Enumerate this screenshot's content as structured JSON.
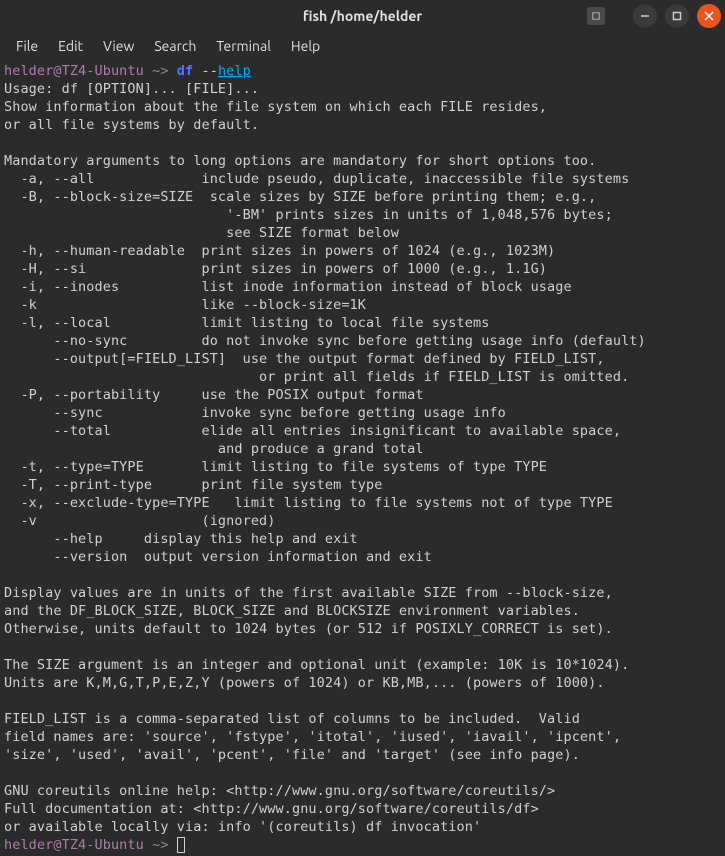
{
  "window": {
    "title": "fish  /home/helder"
  },
  "menu": {
    "file": "File",
    "edit": "Edit",
    "view": "View",
    "search": "Search",
    "terminal": "Terminal",
    "help": "Help"
  },
  "prompt": {
    "user_host": "helder@TZ4-Ubuntu",
    "path_sep": " ~> ",
    "cmd": "df",
    "flag_prefix": " --",
    "flag_name": "help"
  },
  "output": {
    "l01": "Usage: df [OPTION]... [FILE]...",
    "l02": "Show information about the file system on which each FILE resides,",
    "l03": "or all file systems by default.",
    "l04": "",
    "l05": "Mandatory arguments to long options are mandatory for short options too.",
    "l06": "  -a, --all             include pseudo, duplicate, inaccessible file systems",
    "l07": "  -B, --block-size=SIZE  scale sizes by SIZE before printing them; e.g.,",
    "l08": "                           '-BM' prints sizes in units of 1,048,576 bytes;",
    "l09": "                           see SIZE format below",
    "l10": "  -h, --human-readable  print sizes in powers of 1024 (e.g., 1023M)",
    "l11": "  -H, --si              print sizes in powers of 1000 (e.g., 1.1G)",
    "l12": "  -i, --inodes          list inode information instead of block usage",
    "l13": "  -k                    like --block-size=1K",
    "l14": "  -l, --local           limit listing to local file systems",
    "l15": "      --no-sync         do not invoke sync before getting usage info (default)",
    "l16": "      --output[=FIELD_LIST]  use the output format defined by FIELD_LIST,",
    "l17": "                               or print all fields if FIELD_LIST is omitted.",
    "l18": "  -P, --portability     use the POSIX output format",
    "l19": "      --sync            invoke sync before getting usage info",
    "l20": "      --total           elide all entries insignificant to available space,",
    "l21": "                          and produce a grand total",
    "l22": "  -t, --type=TYPE       limit listing to file systems of type TYPE",
    "l23": "  -T, --print-type      print file system type",
    "l24": "  -x, --exclude-type=TYPE   limit listing to file systems not of type TYPE",
    "l25": "  -v                    (ignored)",
    "l26": "      --help     display this help and exit",
    "l27": "      --version  output version information and exit",
    "l28": "",
    "l29": "Display values are in units of the first available SIZE from --block-size,",
    "l30": "and the DF_BLOCK_SIZE, BLOCK_SIZE and BLOCKSIZE environment variables.",
    "l31": "Otherwise, units default to 1024 bytes (or 512 if POSIXLY_CORRECT is set).",
    "l32": "",
    "l33": "The SIZE argument is an integer and optional unit (example: 10K is 10*1024).",
    "l34": "Units are K,M,G,T,P,E,Z,Y (powers of 1024) or KB,MB,... (powers of 1000).",
    "l35": "",
    "l36": "FIELD_LIST is a comma-separated list of columns to be included.  Valid",
    "l37": "field names are: 'source', 'fstype', 'itotal', 'iused', 'iavail', 'ipcent',",
    "l38": "'size', 'used', 'avail', 'pcent', 'file' and 'target' (see info page).",
    "l39": "",
    "l40": "GNU coreutils online help: <http://www.gnu.org/software/coreutils/>",
    "l41": "Full documentation at: <http://www.gnu.org/software/coreutils/df>",
    "l42": "or available locally via: info '(coreutils) df invocation'"
  },
  "prompt2": {
    "user_host": "helder@TZ4-Ubuntu",
    "path_sep": " ~> "
  }
}
